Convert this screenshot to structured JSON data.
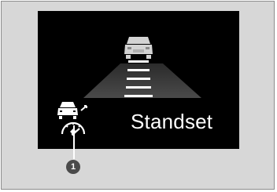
{
  "display": {
    "status_text": "Standset",
    "callout_number": "1"
  },
  "icons": {
    "lead_vehicle": "lead-vehicle-icon",
    "status": "standset-icon"
  },
  "colors": {
    "panel_background": "#d7d7d7",
    "screen_background": "#000000",
    "text": "#ffffff",
    "callout_badge": "#4a4a4a"
  }
}
